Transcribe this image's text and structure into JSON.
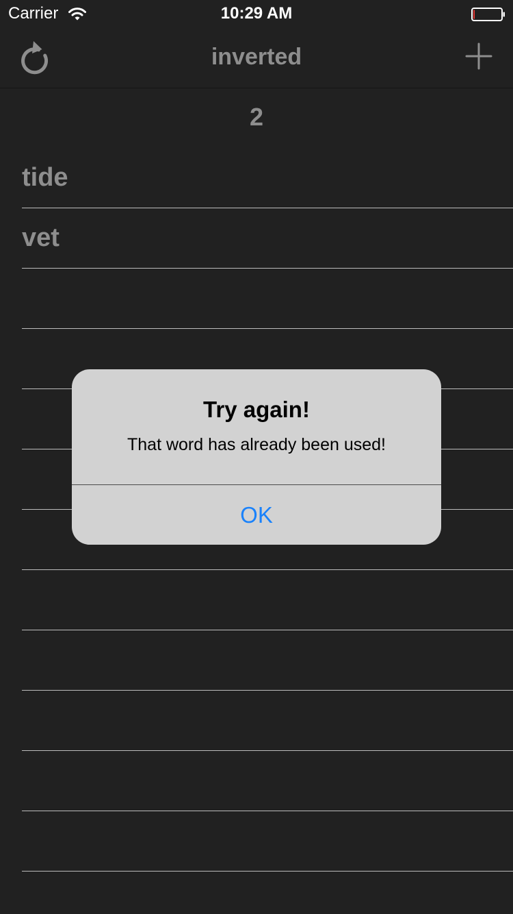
{
  "status_bar": {
    "carrier": "Carrier",
    "time": "10:29 AM",
    "wifi_icon": "wifi-icon",
    "battery_icon": "battery-icon"
  },
  "nav": {
    "title": "inverted",
    "left_icon": "refresh-icon",
    "right_icon": "plus-icon"
  },
  "score": "2",
  "words": [
    {
      "text": "tide"
    },
    {
      "text": "vet"
    },
    {
      "text": ""
    },
    {
      "text": ""
    },
    {
      "text": ""
    },
    {
      "text": ""
    },
    {
      "text": ""
    },
    {
      "text": ""
    },
    {
      "text": ""
    },
    {
      "text": ""
    },
    {
      "text": ""
    },
    {
      "text": ""
    }
  ],
  "alert": {
    "title": "Try again!",
    "message": "That word has already been used!",
    "ok_label": "OK"
  },
  "colors": {
    "background": "#212121",
    "muted_text": "#8e8e8e",
    "separator": "#bdbdbd",
    "alert_background": "#d2d2d2",
    "alert_action": "#1a82fb",
    "battery_low": "#e53935"
  }
}
